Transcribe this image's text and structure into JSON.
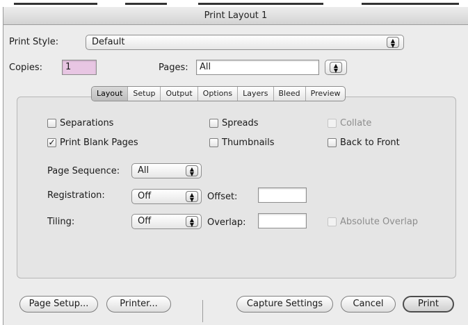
{
  "window": {
    "title": "Print Layout 1"
  },
  "print_style": {
    "label": "Print Style:",
    "value": "Default"
  },
  "copies": {
    "label": "Copies:",
    "value": "1"
  },
  "pages": {
    "label": "Pages:",
    "value": "All"
  },
  "tabs": [
    {
      "label": "Layout",
      "active": true
    },
    {
      "label": "Setup",
      "active": false
    },
    {
      "label": "Output",
      "active": false
    },
    {
      "label": "Options",
      "active": false
    },
    {
      "label": "Layers",
      "active": false
    },
    {
      "label": "Bleed",
      "active": false
    },
    {
      "label": "Preview",
      "active": false
    }
  ],
  "checkboxes": {
    "separations": {
      "label": "Separations",
      "checked": false,
      "enabled": true
    },
    "spreads": {
      "label": "Spreads",
      "checked": false,
      "enabled": true
    },
    "collate": {
      "label": "Collate",
      "checked": false,
      "enabled": false
    },
    "print_blank_pages": {
      "label": "Print Blank Pages",
      "checked": true,
      "enabled": true
    },
    "thumbnails": {
      "label": "Thumbnails",
      "checked": false,
      "enabled": true
    },
    "back_to_front": {
      "label": "Back to Front",
      "checked": false,
      "enabled": true
    },
    "absolute_overlap": {
      "label": "Absolute Overlap",
      "checked": false,
      "enabled": false
    }
  },
  "page_sequence": {
    "label": "Page Sequence:",
    "value": "All"
  },
  "registration": {
    "label": "Registration:",
    "value": "Off"
  },
  "offset": {
    "label": "Offset:",
    "value": ""
  },
  "tiling": {
    "label": "Tiling:",
    "value": "Off"
  },
  "overlap": {
    "label": "Overlap:",
    "value": ""
  },
  "buttons": {
    "page_setup": "Page Setup...",
    "printer": "Printer...",
    "capture_settings": "Capture Settings",
    "cancel": "Cancel",
    "print": "Print"
  },
  "icons": {
    "popup_arrows": "up-down-arrows-icon",
    "checkmark": "checkmark-icon"
  }
}
